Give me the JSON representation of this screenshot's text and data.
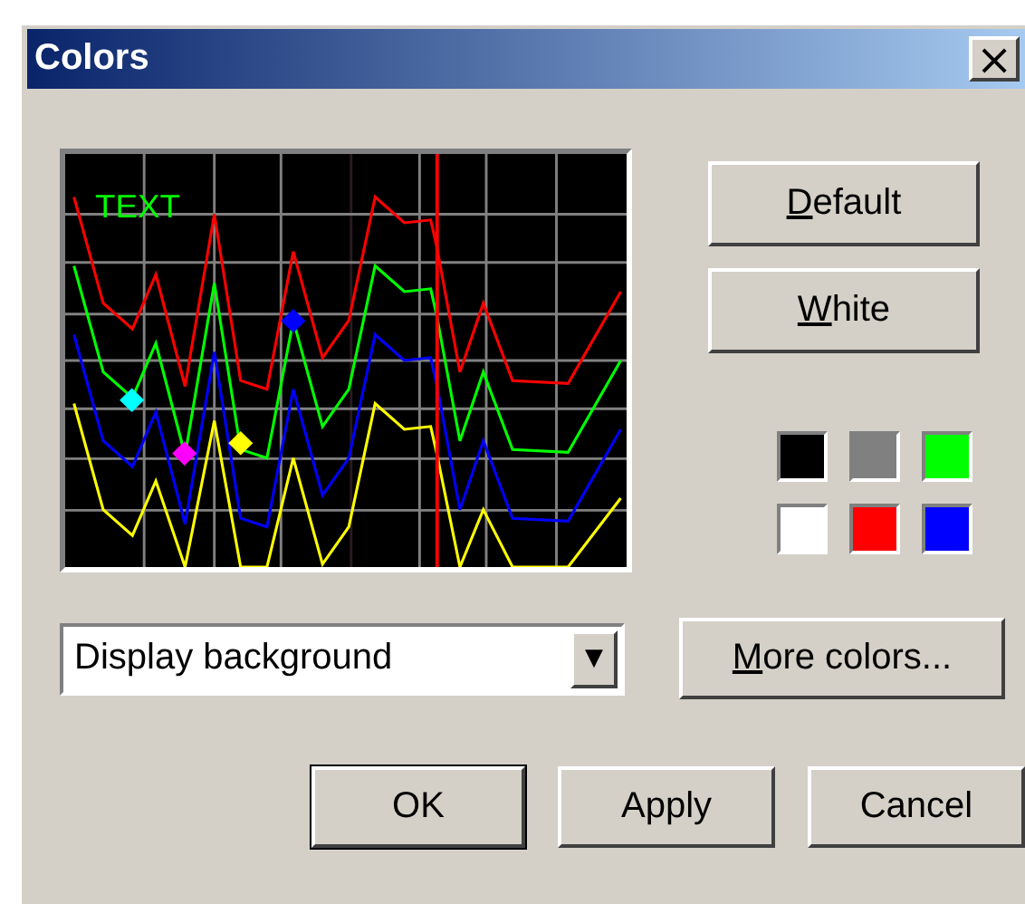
{
  "window": {
    "title": "Colors",
    "close": "×"
  },
  "preview": {
    "label": "TEXT"
  },
  "side_buttons": [
    {
      "mnemonic": "D",
      "rest": "efault"
    },
    {
      "mnemonic": "W",
      "rest": "hite"
    }
  ],
  "swatches": [
    {
      "color": "#000000"
    },
    {
      "color": "#808080"
    },
    {
      "color": "#00ff00"
    },
    {
      "color": "#ffffff"
    },
    {
      "color": "#ff0000"
    },
    {
      "color": "#0000ff"
    }
  ],
  "element_dropdown": {
    "value": "Display background",
    "arrow": "▼"
  },
  "more_colors": {
    "mnemonic": "M",
    "rest": "ore colors..."
  },
  "buttons": [
    {
      "label": "OK",
      "default": true
    },
    {
      "label": "Apply",
      "default": false
    },
    {
      "label": "Cancel",
      "default": false
    }
  ]
}
